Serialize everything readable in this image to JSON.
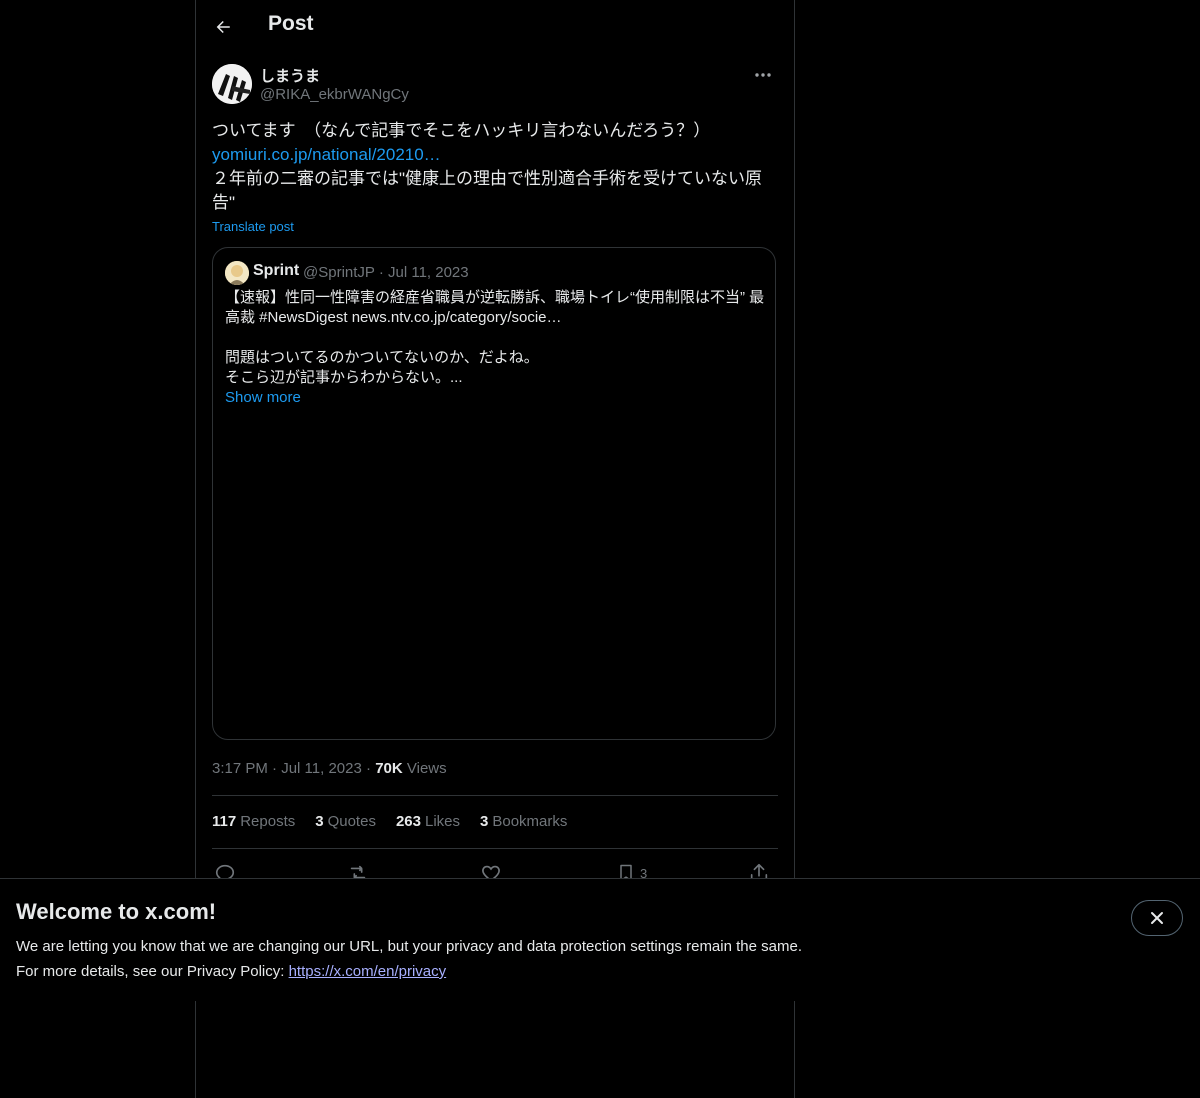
{
  "header": {
    "title": "Post"
  },
  "post": {
    "author_name": "しまうま",
    "author_handle": "@RIKA_ekbrWANgCy",
    "text_line1": "ついてます　（なんで記事でそこをハッキリ言わないんだろう？）",
    "link_text": "yomiuri.co.jp/national/20210…",
    "text_line2": "２年前の二審の記事では\"健康上の理由で性別適合手術を受けていない原告\"",
    "translate_label": "Translate post",
    "time": "3:17 PM",
    "date": "Jul 11, 2023",
    "views_count": "70K",
    "views_label": "Views"
  },
  "quote": {
    "name": "Sprint",
    "handle": "@SprintJP",
    "date": "Jul 11, 2023",
    "text": "【速報】性同一性障害の経産省職員が逆転勝訴、職場トイレ“使用制限は不当” 最高裁 #NewsDigest news.ntv.co.jp/category/socie…\n\n問題はついてるのかついてないのか、だよね。\nそこら辺が記事からわからない。...",
    "show_more": "Show more"
  },
  "stats": {
    "reposts_count": "117",
    "reposts_label": "Reposts",
    "quotes_count": "3",
    "quotes_label": "Quotes",
    "likes_count": "263",
    "likes_label": "Likes",
    "bookmarks_count": "3",
    "bookmarks_label": "Bookmarks"
  },
  "actions": {
    "bookmark_count": "3"
  },
  "banner": {
    "title": "Welcome to x.com!",
    "line1": "We are letting you know that we are changing our URL, but your privacy and data protection settings remain the same.",
    "line2_prefix": "For more details, see our Privacy Policy: ",
    "link": "https://x.com/en/privacy"
  },
  "colors": {
    "background": "#000000",
    "text": "#e7e9ea",
    "muted": "#71767b",
    "accent": "#1d9bf0",
    "border": "#2f3336"
  },
  "icons": [
    "back-arrow-icon",
    "more-icon",
    "reply-icon",
    "repost-icon",
    "like-icon",
    "bookmark-icon",
    "share-icon",
    "close-icon"
  ]
}
